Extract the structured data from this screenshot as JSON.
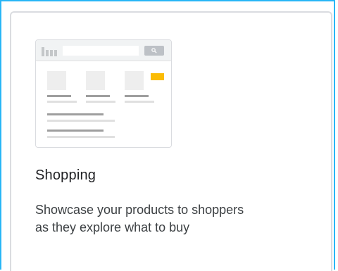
{
  "card": {
    "title": "Shopping",
    "description": "Showcase your products to shoppers as they explore what to buy",
    "illustration_icon": "shopping-page-illustration"
  },
  "colors": {
    "selection_border": "#29b6f6",
    "card_border": "#dadce0",
    "badge": "#fbbc04"
  }
}
